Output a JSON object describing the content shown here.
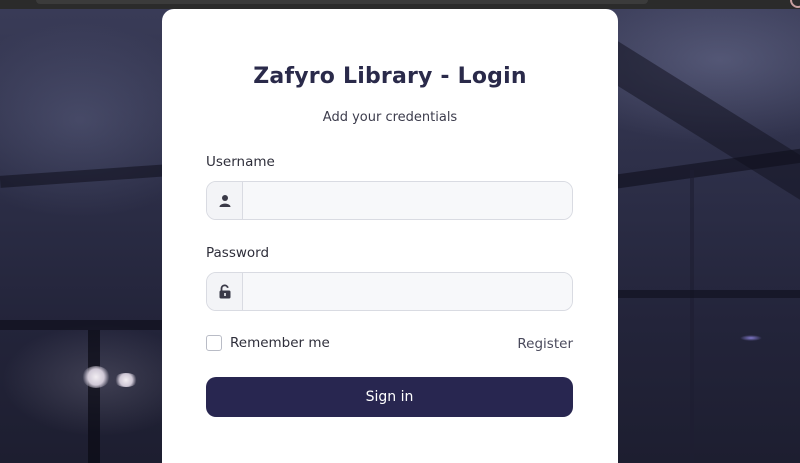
{
  "login": {
    "title_prefix": "Zafyro Library - ",
    "title_emphasis": "Login",
    "subtitle": "Add your credentials",
    "username": {
      "label": "Username",
      "value": "",
      "placeholder": "",
      "icon": "user-icon"
    },
    "password": {
      "label": "Password",
      "value": "",
      "placeholder": "",
      "icon": "unlock-icon"
    },
    "remember_label": "Remember me",
    "remember_checked": false,
    "register_label": "Register",
    "signin_label": "Sign in"
  },
  "colors": {
    "button_bg": "#282650",
    "title_text": "#2a2a4a",
    "card_bg": "#ffffff",
    "input_bg": "#f7f8fa"
  }
}
